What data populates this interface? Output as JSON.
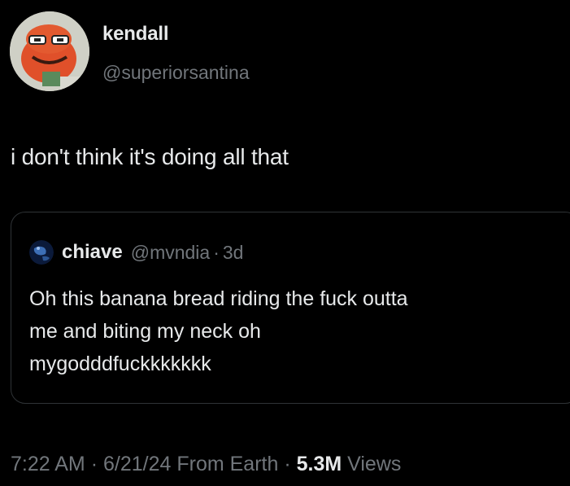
{
  "author": {
    "display_name": "kendall",
    "handle": "@superiorsantina"
  },
  "tweet": {
    "text": "i don't think it's doing all that"
  },
  "quoted_tweet": {
    "display_name": "chiave",
    "handle": "@mvndia",
    "separator": "·",
    "time_ago": "3d",
    "lines": [
      "Oh this banana bread riding the fuck outta",
      "me and biting my neck oh",
      "mygodddfuckkkkkkk"
    ]
  },
  "meta": {
    "time": "7:22 AM",
    "separator": "·",
    "date": "6/21/24",
    "source": "From Earth",
    "views_count": "5.3M",
    "views_label": "Views"
  },
  "colors": {
    "background": "#000000",
    "text_primary": "#e7e9ea",
    "text_secondary": "#71767b",
    "border": "#2f3336"
  },
  "icons": {
    "author_avatar": "cartoon-character-avatar",
    "quote_avatar": "globe-avatar"
  }
}
